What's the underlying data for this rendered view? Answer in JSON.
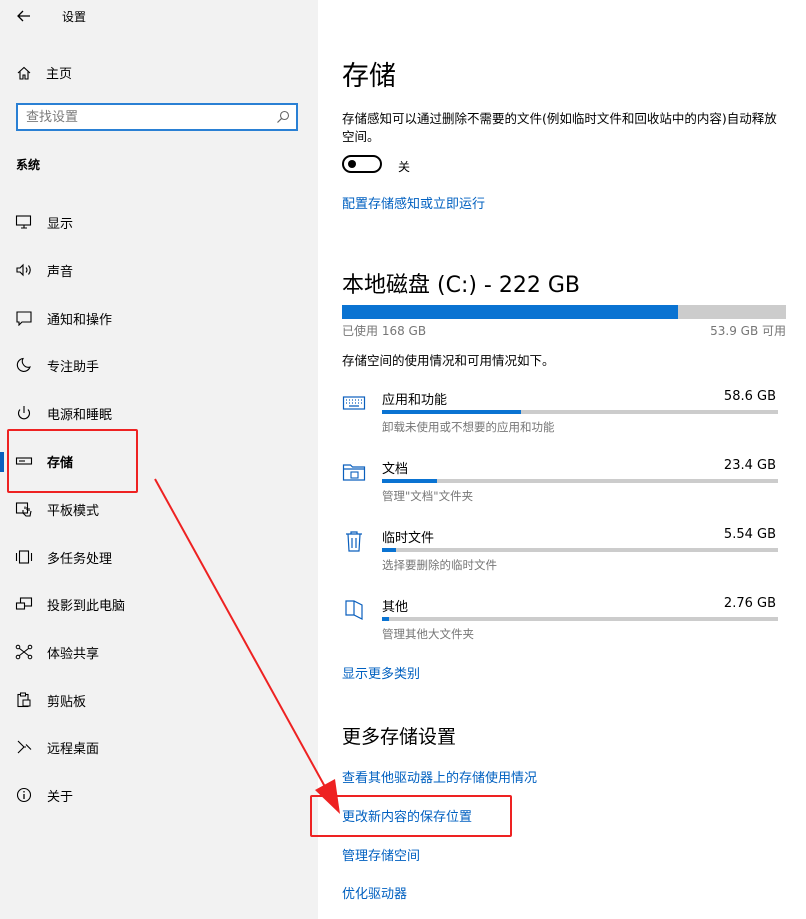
{
  "window": {
    "title": "设置"
  },
  "sidebar": {
    "home_label": "主页",
    "search_placeholder": "查找设置",
    "section_label": "系统",
    "items": [
      {
        "label": "显示",
        "icon": "monitor-icon"
      },
      {
        "label": "声音",
        "icon": "speaker-icon"
      },
      {
        "label": "通知和操作",
        "icon": "notification-icon"
      },
      {
        "label": "专注助手",
        "icon": "moon-icon"
      },
      {
        "label": "电源和睡眠",
        "icon": "power-icon"
      },
      {
        "label": "存储",
        "icon": "storage-icon",
        "selected": true
      },
      {
        "label": "平板模式",
        "icon": "tablet-mode-icon"
      },
      {
        "label": "多任务处理",
        "icon": "multitask-icon"
      },
      {
        "label": "投影到此电脑",
        "icon": "project-icon"
      },
      {
        "label": "体验共享",
        "icon": "share-icon"
      },
      {
        "label": "剪贴板",
        "icon": "clipboard-icon"
      },
      {
        "label": "远程桌面",
        "icon": "remote-desktop-icon"
      },
      {
        "label": "关于",
        "icon": "info-icon"
      }
    ]
  },
  "main": {
    "title": "存储",
    "storage_sense_desc": "存储感知可以通过删除不需要的文件(例如临时文件和回收站中的内容)自动释放空间。",
    "toggle_state": "关",
    "toggle_on": false,
    "configure_link": "配置存储感知或立即运行",
    "disk_title": "本地磁盘 (C:) - 222 GB",
    "used_label": "已使用 168 GB",
    "free_label": "53.9 GB 可用",
    "used_fraction": 0.757,
    "usage_desc": "存储空间的使用情况和可用情况如下。",
    "categories": [
      {
        "title": "应用和功能",
        "size": "58.6 GB",
        "desc": "卸载未使用或不想要的应用和功能",
        "fraction": 0.35,
        "icon": "keyboard-icon"
      },
      {
        "title": "文档",
        "size": "23.4 GB",
        "desc": "管理\"文档\"文件夹",
        "fraction": 0.14,
        "icon": "folder-icon"
      },
      {
        "title": "临时文件",
        "size": "5.54 GB",
        "desc": "选择要删除的临时文件",
        "fraction": 0.035,
        "icon": "trash-icon"
      },
      {
        "title": "其他",
        "size": "2.76 GB",
        "desc": "管理其他大文件夹",
        "fraction": 0.018,
        "icon": "other-files-icon"
      }
    ],
    "show_more_link": "显示更多类别",
    "more_settings_title": "更多存储设置",
    "more_links": [
      "查看其他驱动器上的存储使用情况",
      "更改新内容的保存位置",
      "管理存储空间",
      "优化驱动器"
    ]
  },
  "annotation_color": "#e22222",
  "accent_color": "#0a73d2"
}
